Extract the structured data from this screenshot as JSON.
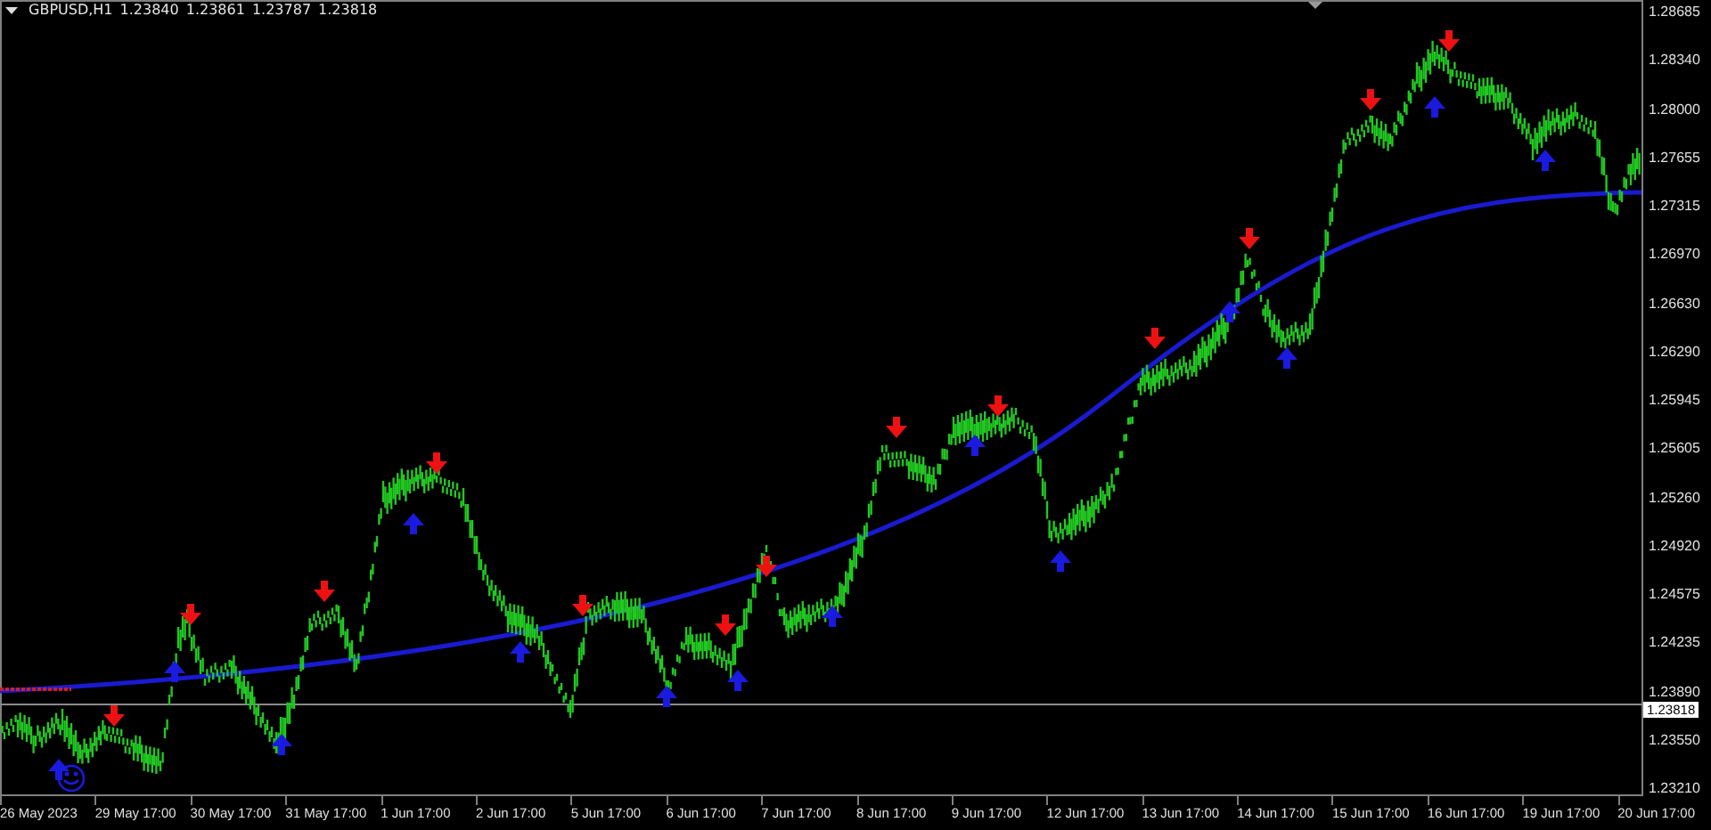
{
  "chart_header": {
    "symbol": "GBPUSD,H1",
    "quotes": [
      "1.23840",
      "1.23861",
      "1.23787",
      "1.23818"
    ]
  },
  "price_axis": {
    "labels": [
      "1.28685",
      "1.28340",
      "1.28000",
      "1.27655",
      "1.27315",
      "1.26970",
      "1.26630",
      "1.26290",
      "1.25945",
      "1.25605",
      "1.25260",
      "1.24920",
      "1.24575",
      "1.24235",
      "1.23890",
      "1.23550",
      "1.23210"
    ],
    "current_price": "1.23818"
  },
  "time_axis": {
    "labels": [
      "26 May 2023",
      "29 May 17:00",
      "30 May 17:00",
      "31 May 17:00",
      "1 Jun 17:00",
      "2 Jun 17:00",
      "5 Jun 17:00",
      "6 Jun 17:00",
      "7 Jun 17:00",
      "8 Jun 17:00",
      "9 Jun 17:00",
      "12 Jun 17:00",
      "13 Jun 17:00",
      "14 Jun 17:00",
      "15 Jun 17:00",
      "16 Jun 17:00",
      "19 Jun 17:00",
      "20 Jun 17:00"
    ]
  }
}
